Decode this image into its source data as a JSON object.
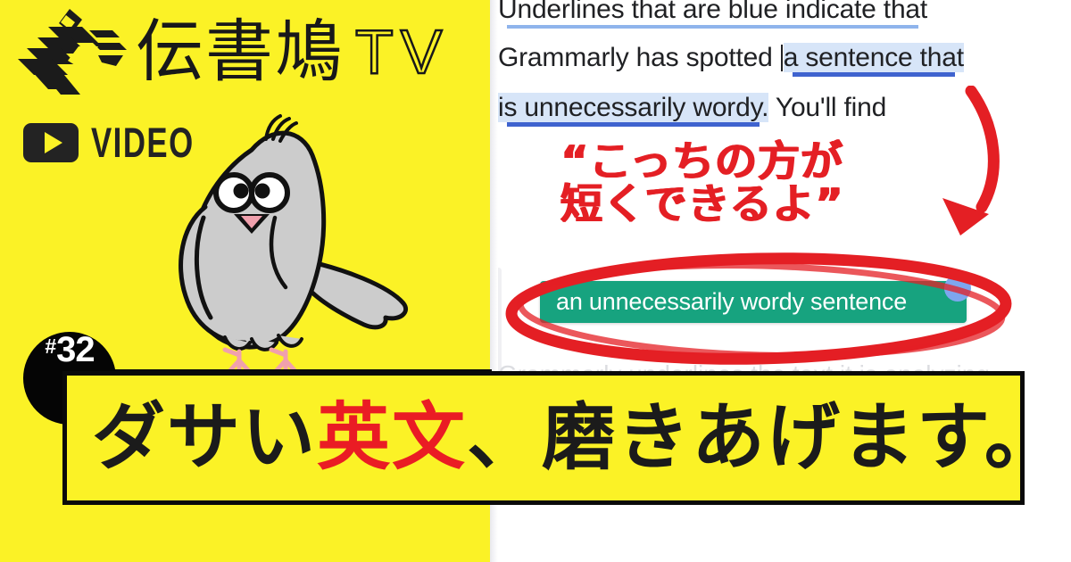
{
  "theme": {
    "yellow": "#fbf226",
    "black": "#0a0a0a",
    "red": "#ea1c24",
    "annotation_red": "#e41f24",
    "green": "#17a37f",
    "blue_underline": "#3f63cf",
    "blue_highlight": "#d7e5f8",
    "bird_gray": "#cccccc",
    "bird_pink": "#f0a0ad"
  },
  "branding": {
    "logo_icon": "pigeon-stripes-logo",
    "channel_kanji": "伝書鳩",
    "channel_tv": "TV",
    "video_badge_label": "VIDEO",
    "play_icon": "play-triangle-icon"
  },
  "episode": {
    "hash": "#",
    "number": "32"
  },
  "mascot": {
    "icon": "pigeon-mascot",
    "perch_line": true
  },
  "headline": {
    "part1": "ダサい",
    "accent": "英文",
    "part2": "、磨きあげます。"
  },
  "document": {
    "lines": [
      {
        "text": "Underlines that are blue indicate that"
      },
      {
        "text": "Grammarly has spotted ",
        "highlight": "a sentence that"
      },
      {
        "highlight": "is unnecessarily wordy.",
        "text": " You'll find"
      }
    ],
    "line1_plain": "Underlines that are blue indicate that",
    "line2_plain": "Grammarly has spotted ",
    "line2_highlight": "a sentence that",
    "line3_highlight": "is unnecessarily wordy.",
    "line3_plain": " You'll find",
    "ghost_line": "Grammarly underlines the text it is analyzing",
    "suggestion_chip": "an unnecessarily wordy sentence",
    "suggestion_dot": "blue-handle-dot"
  },
  "annotation": {
    "note_line1": "“こっちの方が",
    "note_line2": "短くできるよ”",
    "arrow_icon": "hand-drawn-down-arrow",
    "circle_icon": "hand-drawn-red-ellipse"
  }
}
